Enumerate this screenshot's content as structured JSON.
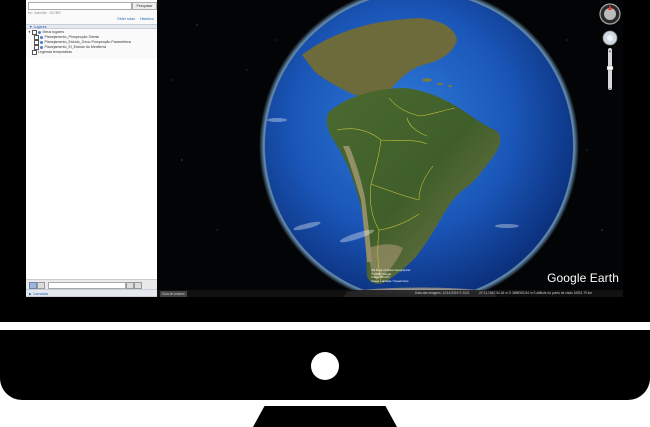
{
  "sidebar": {
    "search_button": "Pesquisar",
    "search_hint": "ex: Joinville - SC/BR",
    "links": [
      "Obter rotas",
      "Histórico"
    ],
    "places_header": "Lugares",
    "tree": [
      {
        "label": "Meus lugares"
      },
      {
        "label": "Planejamento_Prospecção Sísmic"
      },
      {
        "label": "Planejamento_Estudo_Geoo Prospecção Paramétrica"
      },
      {
        "label": "Planejamento_El_Estudo do Mediterrá"
      },
      {
        "label": "Legenda temporárias"
      }
    ],
    "layers_header": "Camadas"
  },
  "map": {
    "brand": "Google Earth",
    "tour_button": "Guia de turismo",
    "attribution": "US Dept of State Geographer\n© 2018 Google\nImage IBCAO\nImage Landsat / Copernicus",
    "status_left": "Data das imagens: 12/14/2015   © 2021",
    "status_right": "21°11.746S 54.46 m O 3686962.84 m S  altitude do ponto de visão 10801.79 km"
  },
  "colors": {
    "border_yellow": "#d8d23a",
    "ocean": "#1c56b7",
    "space": "#030405"
  }
}
